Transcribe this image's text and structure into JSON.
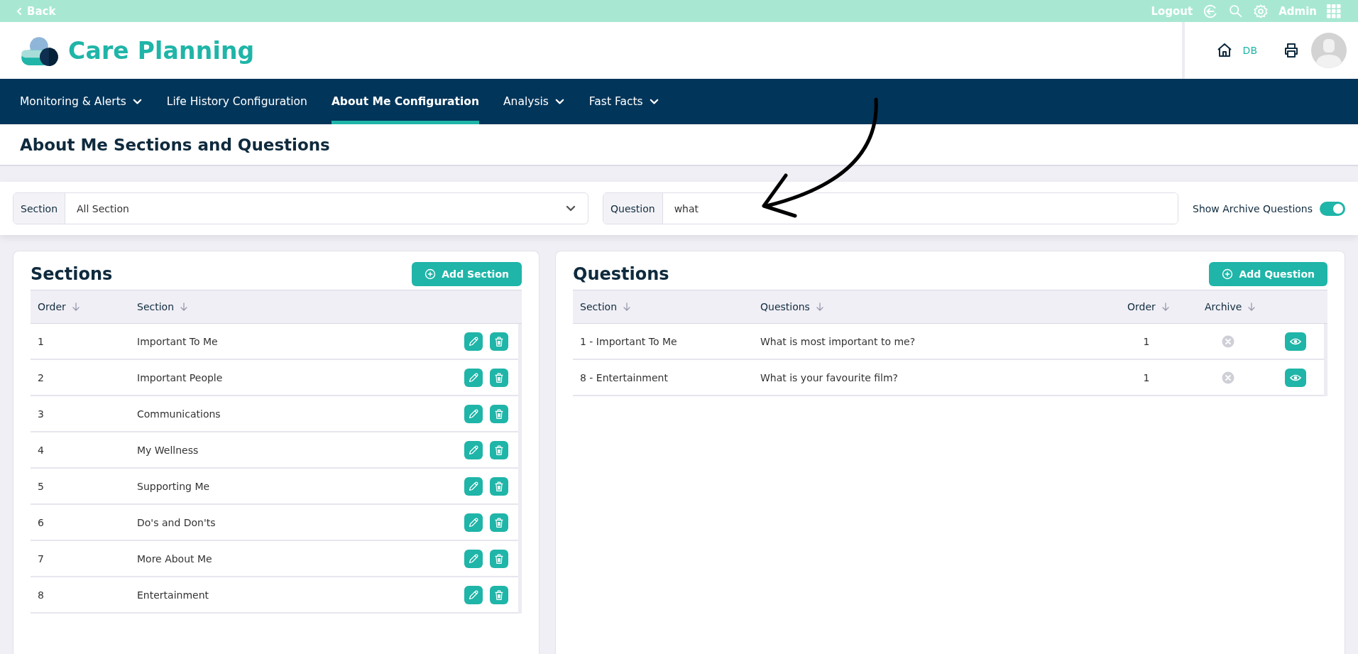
{
  "top_bar": {
    "back": "Back",
    "logout": "Logout",
    "user": "Admin"
  },
  "header": {
    "app_name": "Care Planning",
    "home_label": "DB"
  },
  "nav": [
    {
      "label": "Monitoring & Alerts",
      "dropdown": true,
      "selected": false
    },
    {
      "label": "Life History Configuration",
      "dropdown": false,
      "selected": false
    },
    {
      "label": "About Me Configuration",
      "dropdown": false,
      "selected": true
    },
    {
      "label": "Analysis",
      "dropdown": true,
      "selected": false
    },
    {
      "label": "Fast Facts",
      "dropdown": true,
      "selected": false
    }
  ],
  "page_title": "About Me Sections and Questions",
  "filters": {
    "section": {
      "label": "Section",
      "value": "All Section"
    },
    "question": {
      "label": "Question",
      "value": "what"
    },
    "archive_toggle": {
      "label": "Show Archive Questions",
      "on": true
    }
  },
  "sections_panel": {
    "title": "Sections",
    "add_button": "Add Section",
    "columns": [
      "Order",
      "Section"
    ],
    "rows": [
      {
        "order": "1",
        "section": "Important To Me"
      },
      {
        "order": "2",
        "section": "Important People"
      },
      {
        "order": "3",
        "section": "Communications"
      },
      {
        "order": "4",
        "section": "My Wellness"
      },
      {
        "order": "5",
        "section": "Supporting Me"
      },
      {
        "order": "6",
        "section": "Do's and Don'ts"
      },
      {
        "order": "7",
        "section": "More About Me"
      },
      {
        "order": "8",
        "section": "Entertainment"
      }
    ]
  },
  "questions_panel": {
    "title": "Questions",
    "add_button": "Add Question",
    "columns": [
      "Section",
      "Questions",
      "Order",
      "Archive"
    ],
    "rows": [
      {
        "section": "1 - Important To Me",
        "question": "What is most important to me?",
        "order": "1",
        "archived": false
      },
      {
        "section": "8 - Entertainment",
        "question": "What is your favourite film?",
        "order": "1",
        "archived": false
      }
    ]
  }
}
